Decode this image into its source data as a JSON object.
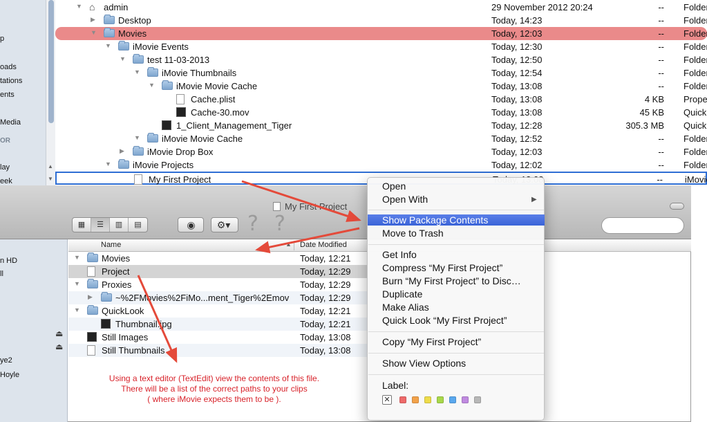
{
  "top_window": {
    "sidebar": [
      {
        "label": "p",
        "kind": "item"
      },
      {
        "label": "oads",
        "kind": "item"
      },
      {
        "label": "tations",
        "kind": "item"
      },
      {
        "label": "ents",
        "kind": "item"
      },
      {
        "label": "Media",
        "kind": "item"
      },
      {
        "label": "OR",
        "kind": "heading"
      },
      {
        "label": "lay",
        "kind": "item"
      },
      {
        "label": "eek",
        "kind": "item"
      }
    ],
    "rows": [
      {
        "name": "admin",
        "icon": "home-icon",
        "tri": "open",
        "indent": 0,
        "date": "29 November 2012 20:24",
        "size": "--",
        "kind": "Folder"
      },
      {
        "name": "Desktop",
        "icon": "folder-icon",
        "tri": "closed",
        "indent": 1,
        "date": "Today, 14:23",
        "size": "--",
        "kind": "Folder"
      },
      {
        "name": "Movies",
        "icon": "folder-icon",
        "tri": "open",
        "indent": 1,
        "date": "Today, 12:03",
        "size": "--",
        "kind": "Folder"
      },
      {
        "name": "iMovie Events",
        "icon": "folder-icon",
        "tri": "open",
        "indent": 2,
        "date": "Today, 12:30",
        "size": "--",
        "kind": "Folder"
      },
      {
        "name": "test 11-03-2013",
        "icon": "folder-icon",
        "tri": "open",
        "indent": 3,
        "date": "Today, 12:50",
        "size": "--",
        "kind": "Folder"
      },
      {
        "name": "iMovie Thumbnails",
        "icon": "folder-icon",
        "tri": "open",
        "indent": 4,
        "date": "Today, 12:54",
        "size": "--",
        "kind": "Folder"
      },
      {
        "name": "iMovie Movie Cache",
        "icon": "folder-icon",
        "tri": "open",
        "indent": 5,
        "date": "Today, 13:08",
        "size": "--",
        "kind": "Folder"
      },
      {
        "name": "Cache.plist",
        "icon": "document-icon",
        "tri": "none",
        "indent": 6,
        "date": "Today, 13:08",
        "size": "4 KB",
        "kind": "Prope"
      },
      {
        "name": "Cache-30.mov",
        "icon": "movie-file-icon",
        "tri": "none",
        "indent": 6,
        "date": "Today, 13:08",
        "size": "45 KB",
        "kind": "Quick"
      },
      {
        "name": "1_Client_Management_Tiger",
        "icon": "movie-file-icon",
        "tri": "none",
        "indent": 5,
        "date": "Today, 12:28",
        "size": "305.3 MB",
        "kind": "Quick"
      },
      {
        "name": "iMovie Movie Cache",
        "icon": "folder-icon",
        "tri": "open",
        "indent": 4,
        "date": "Today, 12:52",
        "size": "--",
        "kind": "Folder"
      },
      {
        "name": "iMovie Drop Box",
        "icon": "folder-icon",
        "tri": "closed",
        "indent": 3,
        "date": "Today, 12:03",
        "size": "--",
        "kind": "Folder"
      },
      {
        "name": "iMovie Projects",
        "icon": "folder-icon",
        "tri": "open",
        "indent": 2,
        "date": "Today, 12:02",
        "size": "--",
        "kind": "Folder"
      },
      {
        "name": "My First Project",
        "icon": "project-icon",
        "tri": "none",
        "indent": 3,
        "date": "Today, 13:08",
        "size": "--",
        "kind": "iMovie"
      }
    ]
  },
  "bottom_window": {
    "title": "My First Project",
    "sidebar": [
      {
        "label": "n HD"
      },
      {
        "label": "ll"
      },
      {
        "label": "ye2"
      },
      {
        "label": "Hoyle"
      }
    ],
    "columns": {
      "name": "Name",
      "date_modified": "Date Modified"
    },
    "rows": [
      {
        "name": "Movies",
        "icon": "folder-icon",
        "tri": "open",
        "indent": 0,
        "date": "Today, 12:21"
      },
      {
        "name": "Project",
        "icon": "document-icon",
        "tri": "none",
        "indent": 0,
        "date": "Today, 12:29"
      },
      {
        "name": "Proxies",
        "icon": "folder-icon",
        "tri": "open",
        "indent": 0,
        "date": "Today, 12:29"
      },
      {
        "name": "~%2FMovies%2FiMo...ment_Tiger%2Emov",
        "icon": "folder-icon",
        "tri": "closed",
        "indent": 1,
        "date": "Today, 12:29"
      },
      {
        "name": "QuickLook",
        "icon": "folder-icon",
        "tri": "open",
        "indent": 0,
        "date": "Today, 12:21"
      },
      {
        "name": "Thumbnail.jpg",
        "icon": "image-file-icon",
        "tri": "none",
        "indent": 1,
        "date": "Today, 12:21"
      },
      {
        "name": "Still Images",
        "icon": "movie-file-icon",
        "tri": "none",
        "indent": 0,
        "date": "Today, 13:08"
      },
      {
        "name": "Still Thumbnails",
        "icon": "document-icon",
        "tri": "none",
        "indent": 0,
        "date": "Today, 13:08"
      }
    ],
    "instructions": [
      "Using a text editor (TextEdit) view the contents of this file.",
      "There will be a list of the correct paths to your clips",
      "( where iMovie expects them to be )."
    ]
  },
  "context_menu": {
    "items": [
      {
        "label": "Open",
        "submenu": false,
        "highlighted": false
      },
      {
        "label": "Open With",
        "submenu": true,
        "highlighted": false
      },
      {
        "label": "Show Package Contents",
        "submenu": false,
        "highlighted": true
      },
      {
        "label": "Move to Trash",
        "submenu": false,
        "highlighted": false
      },
      {
        "label": "Get Info",
        "submenu": false,
        "highlighted": false
      },
      {
        "label": "Compress “My First Project”",
        "submenu": false,
        "highlighted": false
      },
      {
        "label": "Burn “My First Project” to Disc…",
        "submenu": false,
        "highlighted": false
      },
      {
        "label": "Duplicate",
        "submenu": false,
        "highlighted": false
      },
      {
        "label": "Make Alias",
        "submenu": false,
        "highlighted": false
      },
      {
        "label": "Quick Look “My First Project”",
        "submenu": false,
        "highlighted": false
      },
      {
        "label": "Copy “My First Project”",
        "submenu": false,
        "highlighted": false
      },
      {
        "label": "Show View Options",
        "submenu": false,
        "highlighted": false
      }
    ],
    "label_heading": "Label:",
    "label_colors": [
      "#ee6a6a",
      "#f2a24a",
      "#eedc4a",
      "#a8d84a",
      "#5aa8ee",
      "#c08ae0",
      "#b8b8b8"
    ]
  },
  "colors": {
    "selection_row": "#ea8a8a",
    "menu_highlight": "#3a63d8",
    "annotation": "#d8222a"
  }
}
